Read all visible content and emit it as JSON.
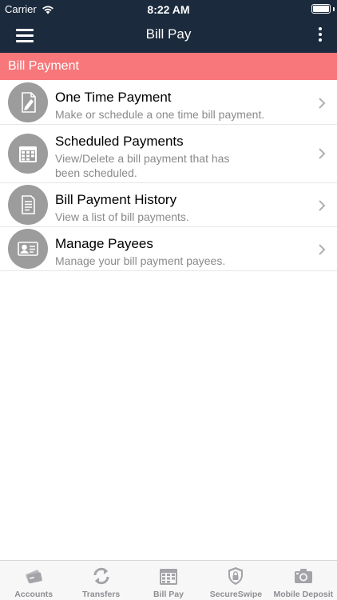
{
  "status_bar": {
    "carrier": "Carrier",
    "time": "8:22 AM"
  },
  "nav": {
    "title": "Bill Pay",
    "menu_icon": "hamburger-icon",
    "more_icon": "kebab-icon"
  },
  "section": {
    "header": "Bill Payment"
  },
  "menu": {
    "items": [
      {
        "title": "One Time Payment",
        "subtitle": "Make or schedule a one time bill payment.",
        "icon": "edit-document-icon"
      },
      {
        "title": "Scheduled Payments",
        "subtitle": "View/Delete a bill payment that has been scheduled.",
        "icon": "calendar-icon"
      },
      {
        "title": "Bill Payment History",
        "subtitle": "View a list of bill payments.",
        "icon": "document-list-icon"
      },
      {
        "title": "Manage Payees",
        "subtitle": "Manage your bill payment payees.",
        "icon": "id-card-icon"
      }
    ]
  },
  "tabs": {
    "items": [
      {
        "label": "Accounts",
        "icon": "cards-icon"
      },
      {
        "label": "Transfers",
        "icon": "refresh-arrows-icon"
      },
      {
        "label": "Bill Pay",
        "icon": "calendar-icon"
      },
      {
        "label": "SecureSwipe",
        "icon": "shield-lock-icon"
      },
      {
        "label": "Mobile Deposit",
        "icon": "camera-icon"
      }
    ]
  },
  "colors": {
    "nav_background": "#1b2a3d",
    "section_header": "#f7777a",
    "icon_circle": "#9c9c9c",
    "tab_inactive": "#8e8e93"
  }
}
